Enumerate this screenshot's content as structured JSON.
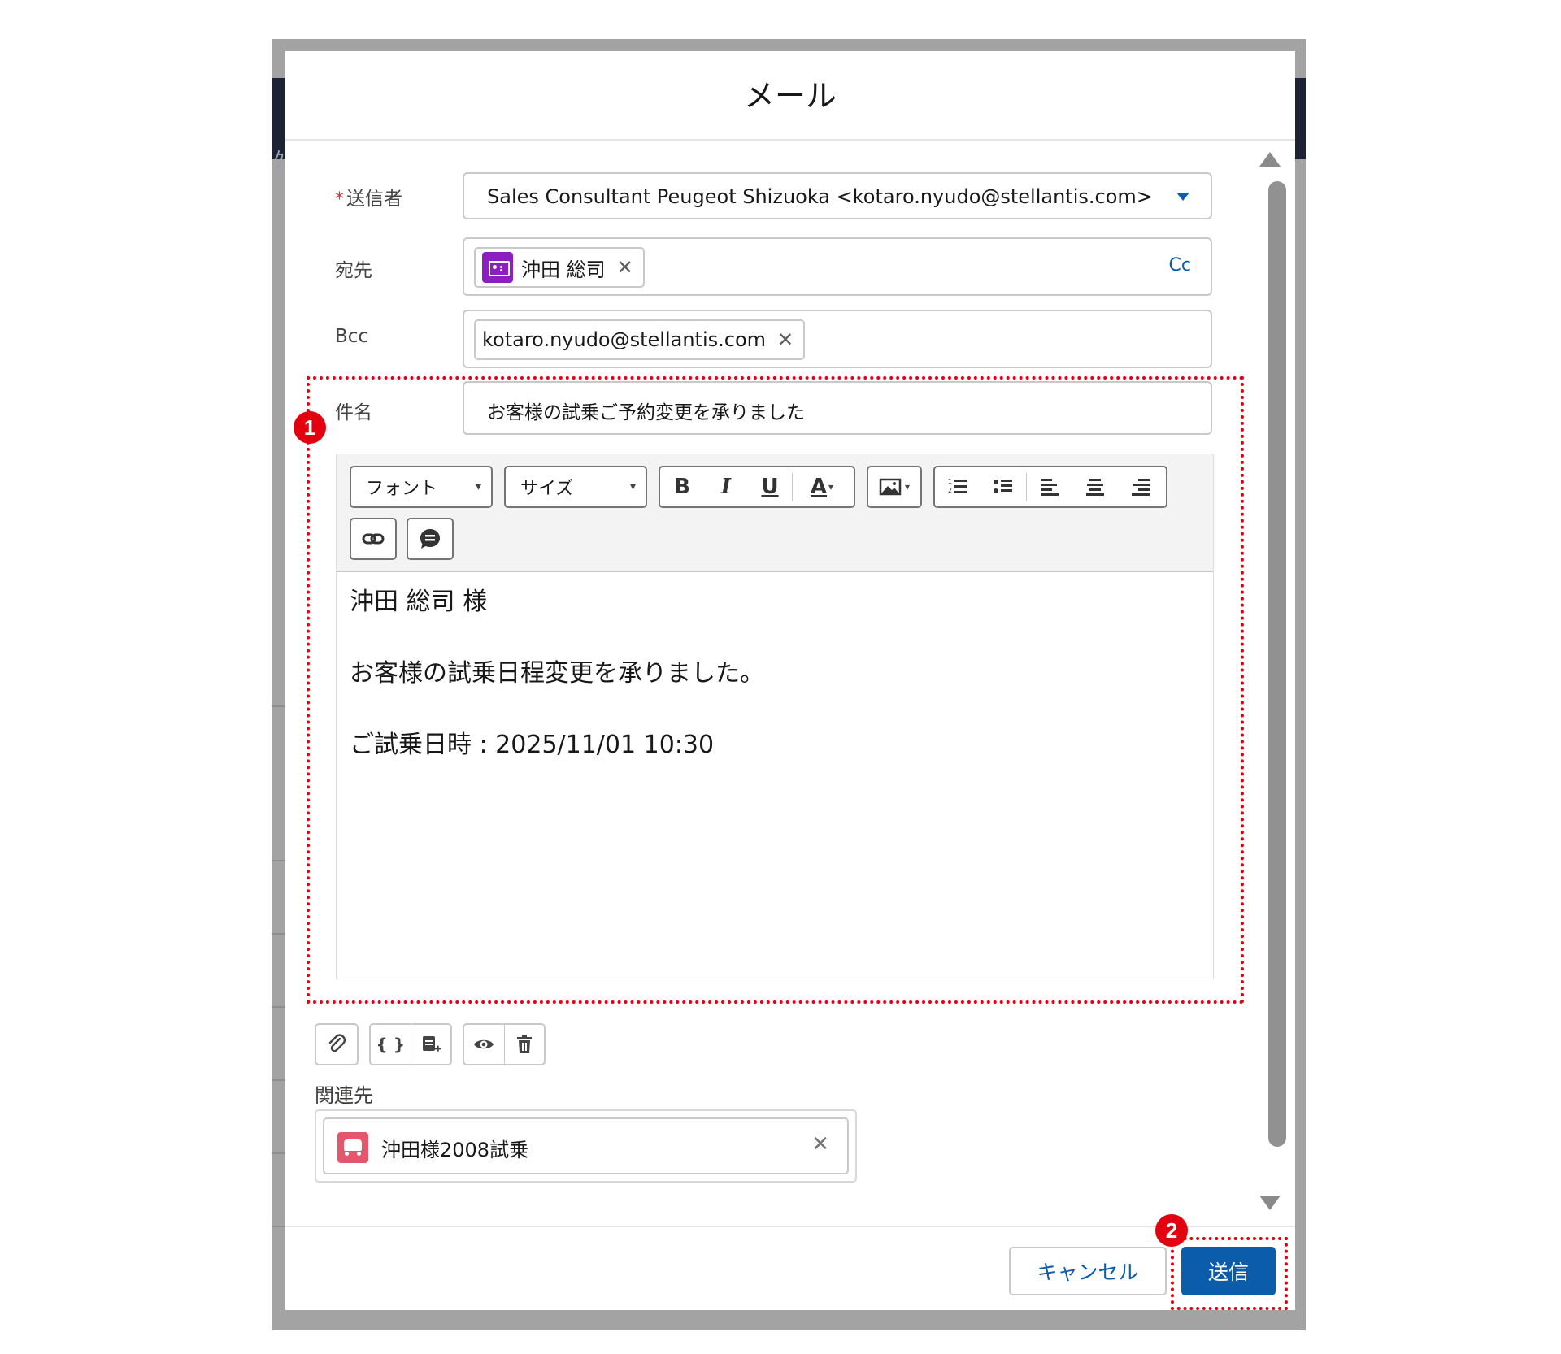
{
  "modal": {
    "title": "メール"
  },
  "form": {
    "from": {
      "label": "送信者",
      "required_mark": "*",
      "value": "Sales Consultant Peugeot Shizuoka <kotaro.nyudo@stellantis.com>"
    },
    "to": {
      "label": "宛先",
      "recipient": "沖田 総司",
      "cc_link": "Cc"
    },
    "bcc": {
      "label": "Bcc",
      "recipient": "kotaro.nyudo@stellantis.com"
    },
    "subject": {
      "label": "件名",
      "value": "お客様の試乗ご予約変更を承りました"
    }
  },
  "editor": {
    "font_dropdown": "フォント",
    "size_dropdown": "サイズ",
    "bold": "B",
    "italic": "I",
    "underline": "U",
    "text_color": "A",
    "body_lines": [
      "沖田 総司 様",
      "お客様の試乗日程変更を承りました。",
      "ご試乗日時 : 2025/11/01 10:30"
    ]
  },
  "tools": {
    "merge_field": "{ }"
  },
  "related": {
    "label": "関連先",
    "value": "沖田様2008試乗"
  },
  "footer": {
    "cancel": "キャンセル",
    "send": "送信"
  },
  "annotations": {
    "callout1": "1",
    "callout2": "2"
  },
  "colors": {
    "brand_blue": "#0b5cab",
    "callout_red": "#e3000f",
    "contact_icon": "#8d1fc2",
    "car_icon": "#e3566b"
  },
  "icons": [
    "contact-icon",
    "close-icon",
    "caret-down-icon",
    "image-icon",
    "numbered-list-icon",
    "bulleted-list-icon",
    "align-left-icon",
    "align-center-icon",
    "align-right-icon",
    "link-icon",
    "comment-icon",
    "attach-icon",
    "template-icon",
    "preview-icon",
    "delete-icon",
    "car-icon"
  ]
}
